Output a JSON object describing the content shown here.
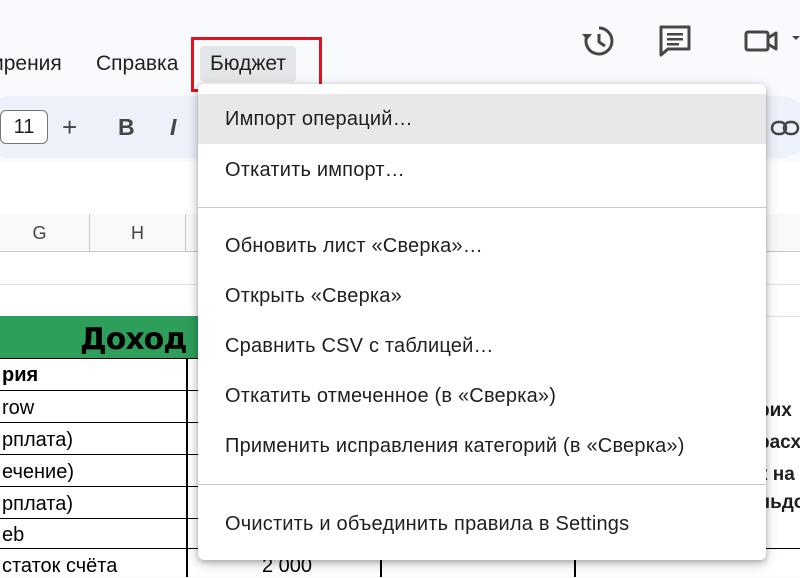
{
  "menubar": {
    "extensions_partial": "ирения",
    "help": "Справка",
    "budget": "Бюджет"
  },
  "toolbar": {
    "font_size": "11",
    "plus": "+",
    "bold": "B",
    "italic": "I"
  },
  "grid": {
    "columns": [
      "G",
      "H"
    ],
    "income_title": "Доход",
    "left_cells": [
      "рия",
      "row",
      "рплата)",
      "ечение)",
      "рплата)",
      "eb",
      "статок счёта"
    ],
    "amount_cell": "2 000",
    "right_cells": [
      "рих",
      "расх",
      "к на",
      "льдо"
    ]
  },
  "dropdown": {
    "items": [
      "Импорт операций…",
      "Откатить импорт…",
      "Обновить лист «Сверка»…",
      "Открыть «Сверка»",
      "Сравнить CSV с таблицей…",
      "Откатить отмеченное (в «Сверка»)",
      "Применить исправления категорий (в «Сверка»)",
      "Очистить и объединить правила в Settings"
    ]
  },
  "icons": [
    "history-icon",
    "comment-icon",
    "video-call-icon",
    "link-icon"
  ]
}
